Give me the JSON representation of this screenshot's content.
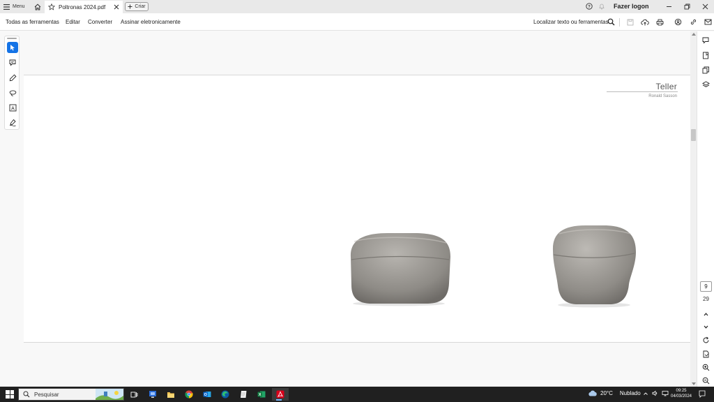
{
  "tabbar": {
    "menu_label": "Menu",
    "doc_tab_title": "Poltronas 2024.pdf",
    "create_label": "Criar",
    "signin_label": "Fazer logon"
  },
  "toolbar": {
    "items": [
      "Todas as ferramentas",
      "Editar",
      "Converter",
      "Assinar eletronicamente"
    ],
    "search_label": "Localizar texto ou ferramentas"
  },
  "left_tools": {
    "icons": [
      "select-cursor-icon",
      "comment-icon",
      "highlight-pen-icon",
      "lasso-icon",
      "text-box-icon",
      "fill-sign-icon"
    ],
    "active_index": 0
  },
  "page": {
    "title": "Teller",
    "subtitle": "Ronald Sasson"
  },
  "page_nav": {
    "current_page": "9",
    "total_pages": "29"
  },
  "taskbar": {
    "search_placeholder": "Pesquisar",
    "weather_temp": "20°C",
    "weather_desc": "Nublado",
    "time": "09:25",
    "date": "04/03/2024"
  },
  "colors": {
    "accent": "#1473e6",
    "acrobat_red": "#d9001b",
    "taskbar": "#202020"
  }
}
